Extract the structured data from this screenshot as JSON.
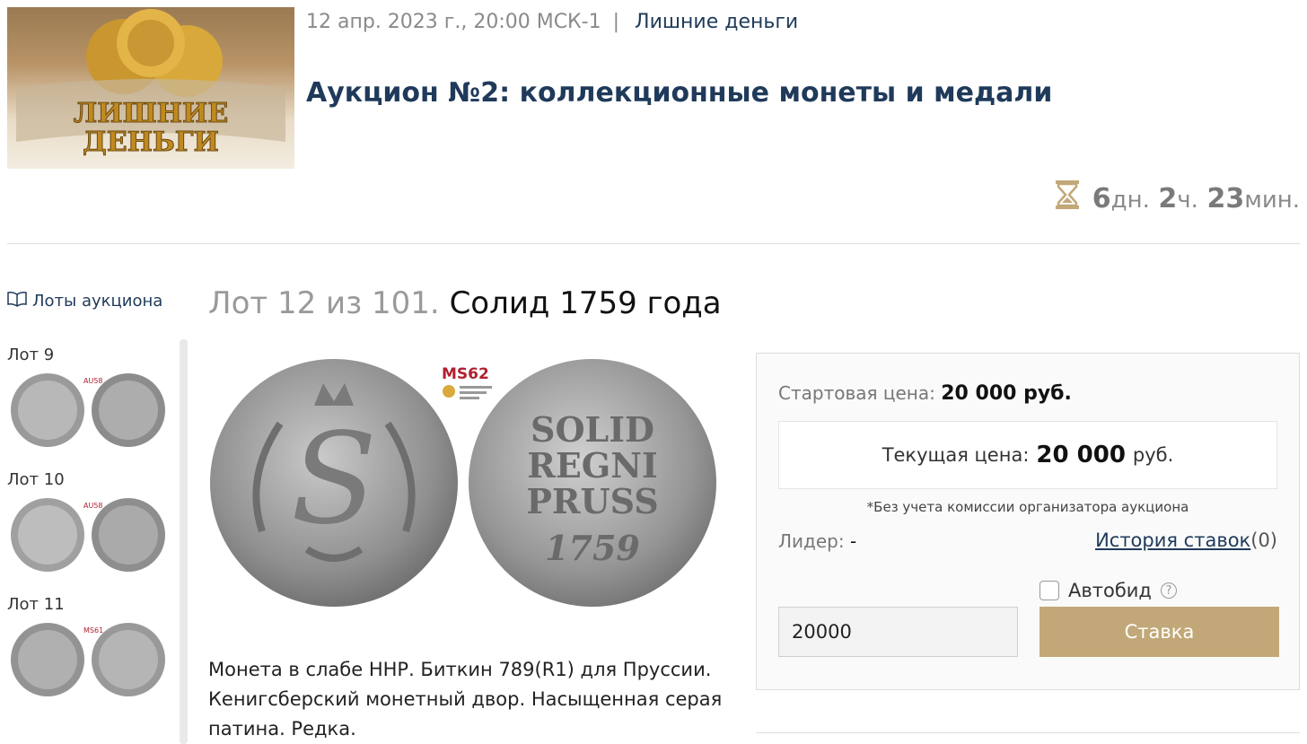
{
  "header": {
    "logo_text_line1": "ЛИШНИЕ",
    "logo_text_line2": "ДЕНЬГИ",
    "date": "12 апр. 2023 г., 20:00 МСК-1",
    "separator": "|",
    "organizer": "Лишние деньги",
    "auction_title": "Аукцион №2: коллекционные монеты и медали"
  },
  "timer": {
    "icon": "hourglass-icon",
    "days": "6",
    "days_unit": "дн.",
    "hours": "2",
    "hours_unit": "ч.",
    "minutes": "23",
    "minutes_unit": "мин."
  },
  "sidebar": {
    "lots_link": "Лоты аукциона",
    "items": [
      {
        "label": "Лот 9",
        "grade": "AU58"
      },
      {
        "label": "Лот 10",
        "grade": "AU58"
      },
      {
        "label": "Лот 11",
        "grade": "MS61"
      }
    ]
  },
  "lot": {
    "number_text": "Лот 12 из 101.",
    "name": "Солид 1759 года",
    "grade": "MS62",
    "reverse_lines": [
      "SOLID",
      "REGNI",
      "PRUSS",
      "1759"
    ],
    "description": "Монета в слабе ННР. Биткин 789(R1) для Пруссии. Кенигсберский монетный двор. Насыщенная серая патина. Редка."
  },
  "bid": {
    "start_label": "Стартовая цена:",
    "start_value": "20 000 руб.",
    "current_label": "Текущая цена:",
    "current_value": "20 000",
    "current_currency": "руб.",
    "note": "*Без учета комиссии организатора аукциона",
    "leader_label": "Лидер:",
    "leader_value": "-",
    "history_label": "История ставок",
    "history_count": "(0)",
    "autobid_label": "Автобид",
    "autobid_checked": false,
    "help_symbol": "?",
    "input_value": "20000",
    "button_label": "Ставка"
  },
  "colors": {
    "accent": "#c2a878",
    "title": "#1f3a5a",
    "muted": "#8a8a8a"
  }
}
